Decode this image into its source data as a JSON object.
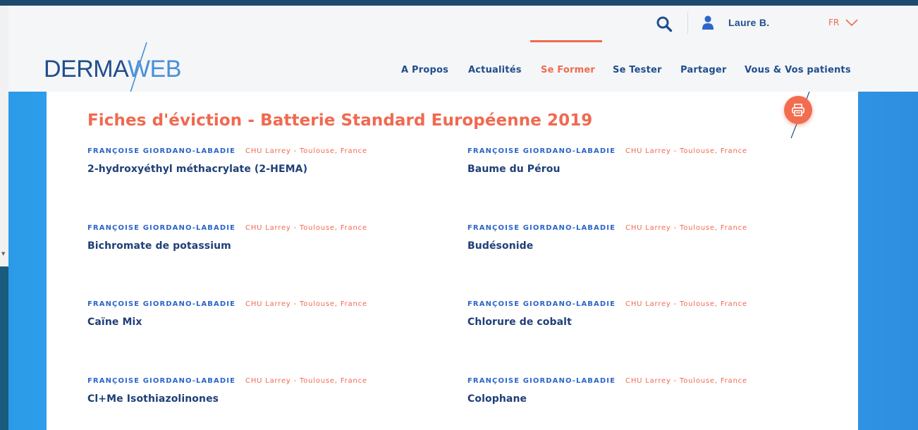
{
  "header": {
    "user_name": "Laure B.",
    "language": "FR",
    "logo": {
      "part1": "DERMA",
      "part2": "WEB"
    },
    "nav": [
      {
        "label": "A Propos",
        "active": false
      },
      {
        "label": "Actualités",
        "active": false
      },
      {
        "label": "Se Former",
        "active": true
      },
      {
        "label": "Se Tester",
        "active": false
      },
      {
        "label": "Partager",
        "active": false
      },
      {
        "label": "Vous & Vos patients",
        "active": false
      }
    ]
  },
  "main": {
    "title": "Fiches d'éviction - Batterie Standard Européenne 2019",
    "entries": [
      {
        "author": "FRANÇOISE GIORDANO-LABADIE",
        "org": "CHU Larrey - Toulouse, France",
        "title": "2-hydroxyéthyl méthacrylate (2-HEMA)"
      },
      {
        "author": "FRANÇOISE GIORDANO-LABADIE",
        "org": "CHU Larrey - Toulouse, France",
        "title": "Baume du Pérou"
      },
      {
        "author": "FRANÇOISE GIORDANO-LABADIE",
        "org": "CHU Larrey - Toulouse, France",
        "title": "Bichromate de potassium"
      },
      {
        "author": "FRANÇOISE GIORDANO-LABADIE",
        "org": "CHU Larrey - Toulouse, France",
        "title": "Budésonide"
      },
      {
        "author": "FRANÇOISE GIORDANO-LABADIE",
        "org": "CHU Larrey - Toulouse, France",
        "title": "Caïne Mix"
      },
      {
        "author": "FRANÇOISE GIORDANO-LABADIE",
        "org": "CHU Larrey - Toulouse, France",
        "title": "Chlorure de cobalt"
      },
      {
        "author": "FRANÇOISE GIORDANO-LABADIE",
        "org": "CHU Larrey - Toulouse, France",
        "title": "Cl+Me Isothiazolinones"
      },
      {
        "author": "FRANÇOISE GIORDANO-LABADIE",
        "org": "CHU Larrey - Toulouse, France",
        "title": "Colophane"
      }
    ]
  },
  "icons": {
    "search": "search-icon",
    "user": "user-icon",
    "language_dropdown": "chevron-down-icon",
    "print": "printer-icon"
  },
  "colors": {
    "brand_navy": "#1f4e8c",
    "accent_coral": "#ef6a50",
    "author_blue": "#2c66c9",
    "background_blue": "#3aa3ec"
  }
}
